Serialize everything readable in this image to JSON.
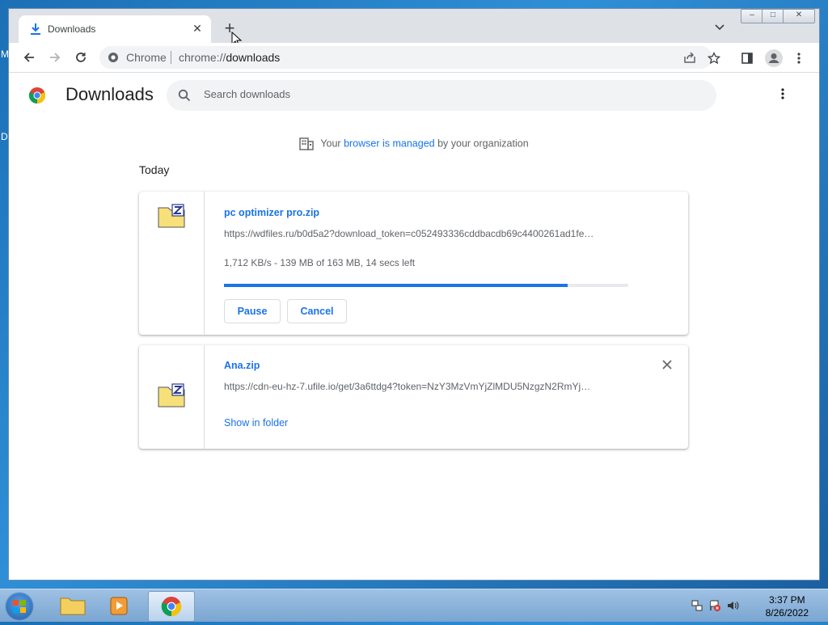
{
  "desktop": {
    "left_fragment_top": "M",
    "left_fragment_mid": "D"
  },
  "tab": {
    "title": "Downloads",
    "close": "✕",
    "new_tab": "+",
    "list": "⌄"
  },
  "window_controls": {
    "minimize": "–",
    "maximize": "□",
    "close": "✕"
  },
  "omnibox": {
    "site": "Chrome",
    "url_scheme": "chrome://",
    "url_host": "downloads"
  },
  "page": {
    "title": "Downloads",
    "search_placeholder": "Search downloads",
    "managed_prefix": "Your ",
    "managed_link": "browser is managed",
    "managed_suffix": " by your organization",
    "section": "Today"
  },
  "downloads": [
    {
      "name": "pc optimizer pro.zip",
      "url": "https://wdfiles.ru/b0d5a2?download_token=c052493336cddbacdb69c4400261ad1fe…",
      "status": "1,712 KB/s - 139 MB of 163 MB, 14 secs left",
      "progress": 0.85,
      "pause_label": "Pause",
      "cancel_label": "Cancel"
    },
    {
      "name": "Ana.zip",
      "url": "https://cdn-eu-hz-7.ufile.io/get/3a6ttdg4?token=NzY3MzVmYjZlMDU5NzgzN2RmYj…",
      "show_label": "Show in folder"
    }
  ],
  "taskbar": {
    "time": "3:37 PM",
    "date": "8/26/2022"
  },
  "colors": {
    "accent": "#1a73e8",
    "text": "#202124",
    "muted": "#5f6368"
  }
}
